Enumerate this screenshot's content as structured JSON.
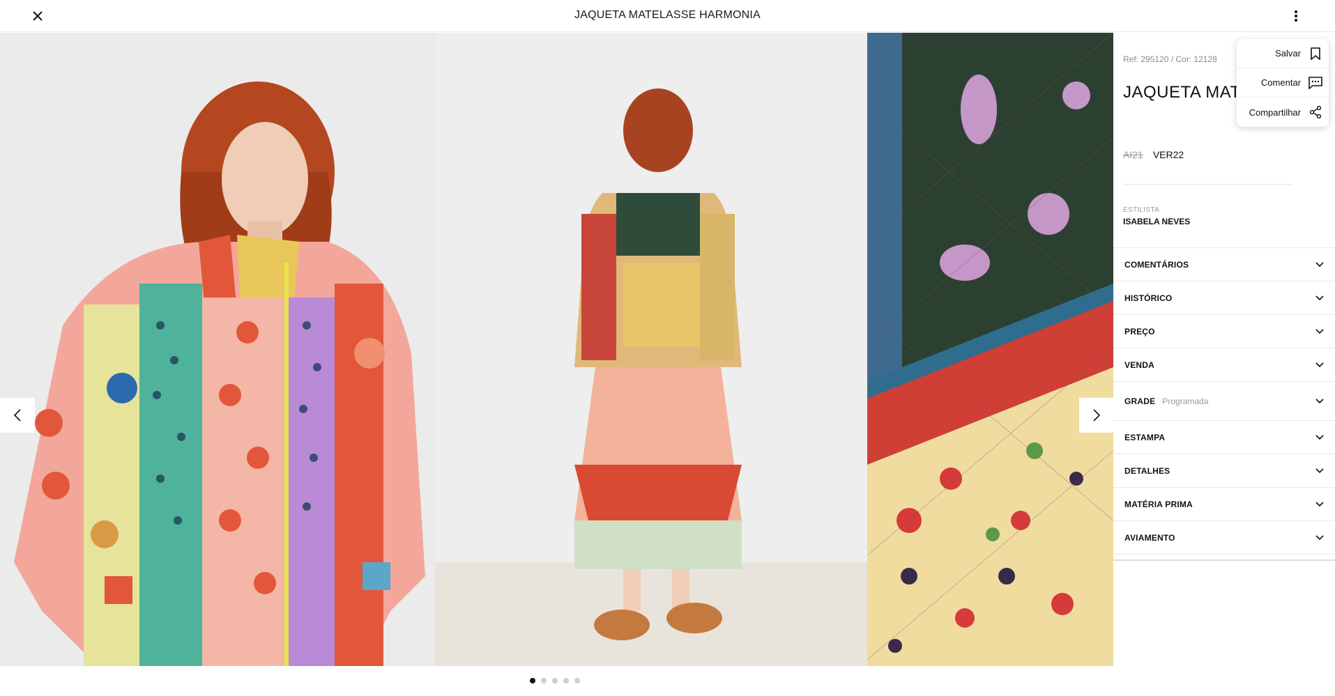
{
  "header": {
    "title": "JAQUETA MATELASSE HARMONIA",
    "close_icon": "close-icon",
    "more_icon": "more-vertical-icon"
  },
  "gallery": {
    "images": [
      {
        "name": "model-front-photo"
      },
      {
        "name": "model-back-photo"
      },
      {
        "name": "fabric-closeup-photo"
      }
    ],
    "prev_icon": "chevron-left-icon",
    "next_icon": "chevron-right-icon",
    "dots": {
      "count": 5,
      "active": 0
    }
  },
  "details": {
    "ref": "Ref: 295120 / Cor: 12128",
    "title": "JAQUETA MATELASSE HARMONIA",
    "season_old": "AI21",
    "season_new": "VER22",
    "stylist_label": "ESTILISTA",
    "stylist_name": "ISABELA NEVES"
  },
  "accordion": [
    {
      "label": "COMENTÁRIOS",
      "sub": ""
    },
    {
      "label": "HISTÓRICO",
      "sub": ""
    },
    {
      "label": "PREÇO",
      "sub": ""
    },
    {
      "label": "VENDA",
      "sub": ""
    },
    {
      "label": "GRADE",
      "sub": "Programada"
    },
    {
      "label": "ESTAMPA",
      "sub": ""
    },
    {
      "label": "DETALHES",
      "sub": ""
    },
    {
      "label": "MATÉRIA PRIMA",
      "sub": ""
    },
    {
      "label": "AVIAMENTO",
      "sub": ""
    }
  ],
  "menu": {
    "items": [
      {
        "label": "Salvar",
        "icon": "bookmark-icon"
      },
      {
        "label": "Comentar",
        "icon": "comment-icon"
      },
      {
        "label": "Compartilhar",
        "icon": "share-icon"
      }
    ]
  },
  "colors": {
    "accent": "#111111",
    "muted": "#9a9a9a",
    "divider": "#e8e8e8"
  }
}
